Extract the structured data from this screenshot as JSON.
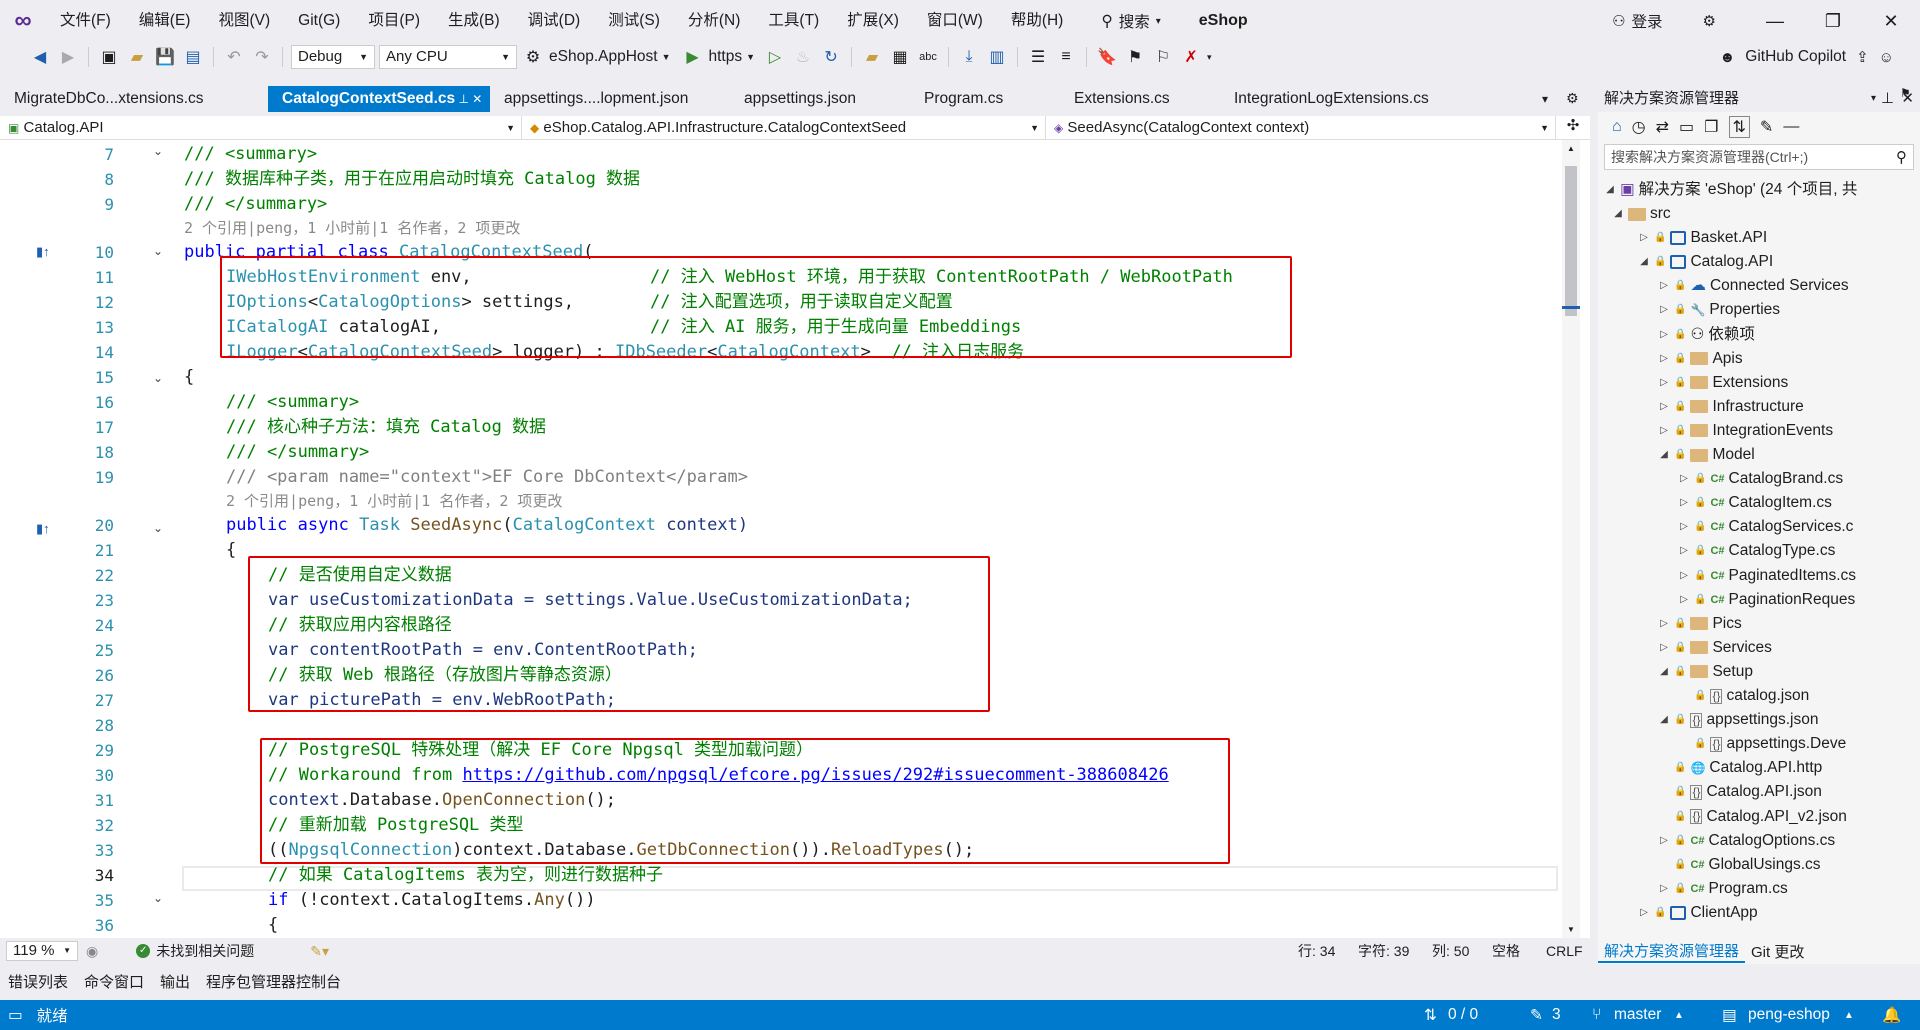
{
  "menu": {
    "items": [
      "文件(F)",
      "编辑(E)",
      "视图(V)",
      "Git(G)",
      "项目(P)",
      "生成(B)",
      "调试(D)",
      "测试(S)",
      "分析(N)",
      "工具(T)",
      "扩展(X)",
      "窗口(W)",
      "帮助(H)"
    ],
    "search_label": "搜索",
    "app_title": "eShop",
    "login_label": "登录"
  },
  "toolbar": {
    "config": "Debug",
    "platform": "Any CPU",
    "startup_project": "eShop.AppHost",
    "run_profile": "https",
    "copilot_label": "GitHub Copilot"
  },
  "tabs": [
    {
      "label": "MigrateDbCo...xtensions.cs",
      "active": false
    },
    {
      "label": "CatalogContextSeed.cs",
      "active": true
    },
    {
      "label": "appsettings....lopment.json",
      "active": false
    },
    {
      "label": "appsettings.json",
      "active": false
    },
    {
      "label": "Program.cs",
      "active": false
    },
    {
      "label": "Extensions.cs",
      "active": false
    },
    {
      "label": "IntegrationLogExtensions.cs",
      "active": false
    }
  ],
  "nav": {
    "project": "Catalog.API",
    "type": "eShop.Catalog.API.Infrastructure.CatalogContextSeed",
    "member": "SeedAsync(CatalogContext context)"
  },
  "code": {
    "line_numbers": [
      "7",
      "8",
      "9",
      "10",
      "11",
      "12",
      "13",
      "14",
      "15",
      "16",
      "17",
      "18",
      "19",
      "20",
      "21",
      "22",
      "23",
      "24",
      "25",
      "26",
      "27",
      "28",
      "29",
      "30",
      "31",
      "32",
      "33",
      "34",
      "35",
      "36"
    ],
    "current_line": "34",
    "lens_1": "2 个引用|peng，1 小时前|1 名作者，2 项更改",
    "lens_2": "2 个引用|peng，1 小时前|1 名作者，2 项更改",
    "l7": "/// <summary>",
    "l8": "/// 数据库种子类，用于在应用启动时填充 Catalog 数据",
    "l9": "/// </summary>",
    "l10_kw": "public partial class",
    "l10_name": "CatalogContextSeed",
    "l11_type": "IWebHostEnvironment",
    "l11_name": " env,",
    "l11_cmt": "// 注入 WebHost 环境，用于获取 ContentRootPath / WebRootPath",
    "l12_type": "IOptions",
    "l12_gen": "CatalogOptions",
    "l12_name": " settings,",
    "l12_cmt": "// 注入配置选项，用于读取自定义配置",
    "l13_type": "ICatalogAI",
    "l13_name": " catalogAI,",
    "l13_cmt": "// 注入 AI 服务，用于生成向量 Embeddings",
    "l14_type": "ILogger",
    "l14_gen": "CatalogContextSeed",
    "l14_name": " logger) : ",
    "l14_iface": "IDbSeeder",
    "l14_gen2": "CatalogContext",
    "l14_cmt": "// 注入日志服务",
    "l15": "{",
    "l16": "/// <summary>",
    "l17": "/// 核心种子方法：填充 Catalog 数据",
    "l18": "/// </summary>",
    "l19": "/// <param name=\"context\">EF Core DbContext</param>",
    "l20_kw": "public async",
    "l20_type": "Task",
    "l20_name": "SeedAsync",
    "l20_ptype": "CatalogContext",
    "l20_param": " context)",
    "l21": "{",
    "l22": "// 是否使用自定义数据",
    "l23": "var useCustomizationData = settings.Value.UseCustomizationData;",
    "l24": "// 获取应用内容根路径",
    "l25": "var contentRootPath = env.ContentRootPath;",
    "l26": "// 获取 Web 根路径（存放图片等静态资源）",
    "l27": "var picturePath = env.WebRootPath;",
    "l29": "// PostgreSQL 特殊处理（解决 EF Core Npgsql 类型加载问题）",
    "l30_pre": "// Workaround from ",
    "l30_link": "https://github.com/npgsql/efcore.pg/issues/292#issuecomment-388608426",
    "l31_a": "context",
    "l31_b": ".Database.",
    "l31_c": "OpenConnection",
    "l31_d": "();",
    "l32": "// 重新加载 PostgreSQL 类型",
    "l33_a": "((",
    "l33_b": "NpgsqlConnection",
    "l33_c": ")context.Database.",
    "l33_d": "GetDbConnection",
    "l33_e": "()).",
    "l33_f": "ReloadTypes",
    "l33_g": "();",
    "l34": "// 如果 CatalogItems 表为空，则进行数据种子",
    "l35_kw": "if",
    "l35_rest": " (!context.CatalogItems.",
    "l35_m": "Any",
    "l35_end": "())",
    "l36": "{"
  },
  "editor_status": {
    "zoom": "119 %",
    "issues": "未找到相关问题",
    "line": "行: 34",
    "char": "字符: 39",
    "col": "列: 50",
    "whitespace": "空格",
    "eol": "CRLF"
  },
  "solution_explorer": {
    "title": "解决方案资源管理器",
    "search_placeholder": "搜索解决方案资源管理器(Ctrl+;)",
    "solution": "解决方案 'eShop' (24 个项目, 共",
    "items": [
      {
        "label": "src",
        "kind": "folder"
      },
      {
        "label": "Basket.API",
        "kind": "project"
      },
      {
        "label": "Catalog.API",
        "kind": "project"
      },
      {
        "label": "Connected Services",
        "kind": "service"
      },
      {
        "label": "Properties",
        "kind": "properties"
      },
      {
        "label": "依赖项",
        "kind": "deps"
      },
      {
        "label": "Apis",
        "kind": "folder"
      },
      {
        "label": "Extensions",
        "kind": "folder"
      },
      {
        "label": "Infrastructure",
        "kind": "folder"
      },
      {
        "label": "IntegrationEvents",
        "kind": "folder"
      },
      {
        "label": "Model",
        "kind": "folder"
      },
      {
        "label": "CatalogBrand.cs",
        "kind": "cs"
      },
      {
        "label": "CatalogItem.cs",
        "kind": "cs"
      },
      {
        "label": "CatalogServices.c",
        "kind": "cs"
      },
      {
        "label": "CatalogType.cs",
        "kind": "cs"
      },
      {
        "label": "PaginatedItems.cs",
        "kind": "cs"
      },
      {
        "label": "PaginationReques",
        "kind": "cs"
      },
      {
        "label": "Pics",
        "kind": "folder"
      },
      {
        "label": "Services",
        "kind": "folder"
      },
      {
        "label": "Setup",
        "kind": "folder"
      },
      {
        "label": "catalog.json",
        "kind": "json"
      },
      {
        "label": "appsettings.json",
        "kind": "json"
      },
      {
        "label": "appsettings.Deve",
        "kind": "json"
      },
      {
        "label": "Catalog.API.http",
        "kind": "http"
      },
      {
        "label": "Catalog.API.json",
        "kind": "json"
      },
      {
        "label": "Catalog.API_v2.json",
        "kind": "json"
      },
      {
        "label": "CatalogOptions.cs",
        "kind": "cs"
      },
      {
        "label": "GlobalUsings.cs",
        "kind": "cs"
      },
      {
        "label": "Program.cs",
        "kind": "cs"
      },
      {
        "label": "ClientApp",
        "kind": "project"
      }
    ],
    "tab_solution": "解决方案资源管理器",
    "tab_git": "Git 更改"
  },
  "bottom_tabs": [
    "错误列表",
    "命令窗口",
    "输出",
    "程序包管理器控制台"
  ],
  "statusbar": {
    "ready": "就绪",
    "sync": "0 / 0",
    "edits": "3",
    "branch": "master",
    "repo": "peng-eshop"
  },
  "colors": {
    "accent": "#007acc",
    "highlight_box": "#e00000"
  }
}
